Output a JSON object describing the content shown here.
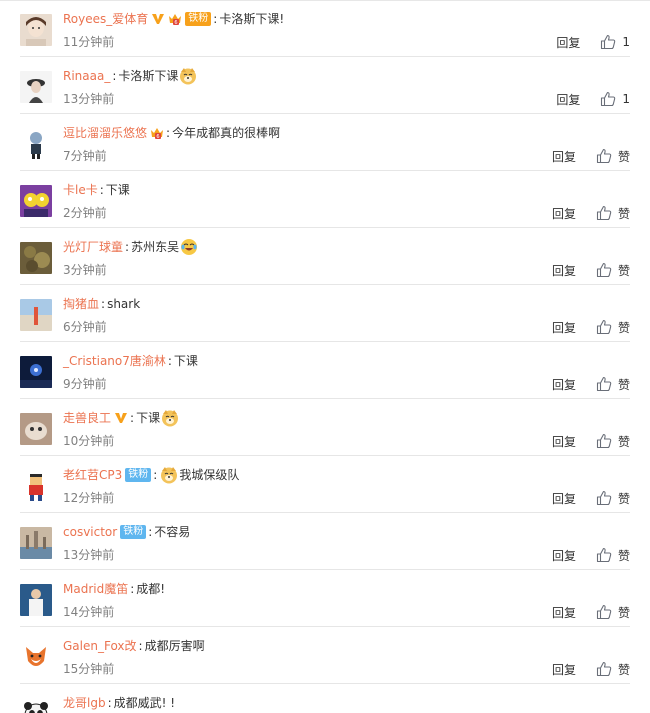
{
  "actions": {
    "reply_label": "回复",
    "like_label": "赞"
  },
  "comments": [
    {
      "username": "Royees_爱体育",
      "verified": true,
      "crown": true,
      "fan_badge": {
        "style": "gold",
        "label": "铁粉"
      },
      "text": "卡洛斯下课!",
      "emoji": "",
      "emoji_pos": "",
      "time": "11分钟前",
      "like_text": "1",
      "avatar": "face-light"
    },
    {
      "username": "Rinaaa_",
      "verified": false,
      "crown": false,
      "fan_badge": null,
      "text": "卡洛斯下课",
      "emoji": "doge-emoji",
      "emoji_pos": "after",
      "time": "13分钟前",
      "like_text": "1",
      "avatar": "person-hat"
    },
    {
      "username": "逗比溜溜乐悠悠",
      "verified": false,
      "crown": true,
      "fan_badge": null,
      "text": "今年成都真的很棒啊",
      "emoji": "",
      "emoji_pos": "",
      "time": "7分钟前",
      "like_text": "赞",
      "avatar": "cartoon-man"
    },
    {
      "username": "卡le卡",
      "verified": false,
      "crown": false,
      "fan_badge": null,
      "text": "下课",
      "emoji": "",
      "emoji_pos": "",
      "time": "2分钟前",
      "like_text": "赞",
      "avatar": "simpsons"
    },
    {
      "username": "光灯厂球童",
      "verified": false,
      "crown": false,
      "fan_badge": null,
      "text": "苏州东吴",
      "emoji": "laugh-cry-emoji",
      "emoji_pos": "after",
      "time": "3分钟前",
      "like_text": "赞",
      "avatar": "plant"
    },
    {
      "username": "掏猪血",
      "verified": false,
      "crown": false,
      "fan_badge": null,
      "text": "shark",
      "emoji": "",
      "emoji_pos": "",
      "time": "6分钟前",
      "like_text": "赞",
      "avatar": "beach"
    },
    {
      "username": "_Cristiano7唐渝林",
      "verified": false,
      "crown": false,
      "fan_badge": null,
      "text": "下课",
      "emoji": "",
      "emoji_pos": "",
      "time": "9分钟前",
      "like_text": "赞",
      "avatar": "stage"
    },
    {
      "username": "走兽良工",
      "verified": true,
      "crown": false,
      "fan_badge": null,
      "text": "下课",
      "emoji": "doge-emoji",
      "emoji_pos": "after",
      "time": "10分钟前",
      "like_text": "赞",
      "avatar": "cat"
    },
    {
      "username": "老红苕CP3",
      "verified": false,
      "crown": false,
      "fan_badge": {
        "style": "blue",
        "label": "铁粉"
      },
      "text": "我城保级队",
      "emoji": "doge-emoji",
      "emoji_pos": "before",
      "time": "12分钟前",
      "like_text": "赞",
      "avatar": "pixel-man"
    },
    {
      "username": "cosvictor",
      "verified": false,
      "crown": false,
      "fan_badge": {
        "style": "blue",
        "label": "铁粉"
      },
      "text": "不容易",
      "emoji": "",
      "emoji_pos": "",
      "time": "13分钟前",
      "like_text": "赞",
      "avatar": "city"
    },
    {
      "username": "Madrid魔笛",
      "verified": false,
      "crown": false,
      "fan_badge": null,
      "text": "成都!",
      "emoji": "",
      "emoji_pos": "",
      "time": "14分钟前",
      "like_text": "赞",
      "avatar": "football-player"
    },
    {
      "username": "Galen_Fox改",
      "verified": false,
      "crown": false,
      "fan_badge": null,
      "text": "成都厉害啊",
      "emoji": "",
      "emoji_pos": "",
      "time": "15分钟前",
      "like_text": "赞",
      "avatar": "fox"
    },
    {
      "username": "龙哥lgb",
      "verified": false,
      "crown": false,
      "fan_badge": null,
      "text": "成都威武! !",
      "emoji": "",
      "emoji_pos": "",
      "time": "",
      "like_text": "",
      "avatar": "panda"
    }
  ],
  "colors": {
    "username": "#eb7350",
    "text": "#333333",
    "time": "#808080",
    "divider": "#e6e6e6",
    "vip": "#f7a11b",
    "fan_gold": "#f7a11b",
    "fan_blue": "#5fb6ef"
  }
}
